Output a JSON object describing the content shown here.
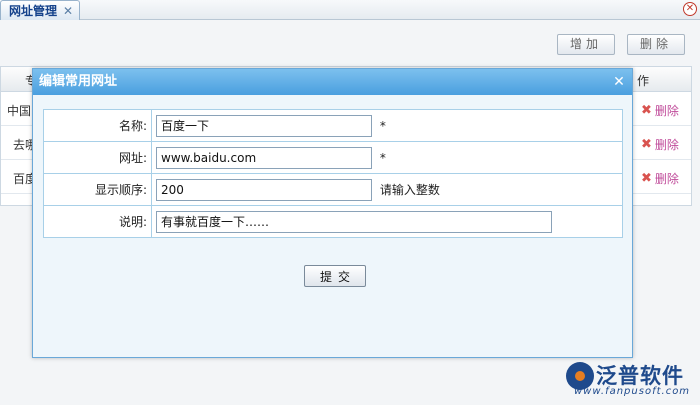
{
  "tab": {
    "label": "网址管理",
    "close_glyph": "✕"
  },
  "window_close_glyph": "✕",
  "toolbar": {
    "add_label": "增加",
    "delete_label": "删除"
  },
  "grid": {
    "header_left_partial": "专",
    "header_right_partial": "作",
    "rows": [
      {
        "name_partial": "中国",
        "delete_label": "删除"
      },
      {
        "name_partial": "去哪",
        "delete_label": "删除"
      },
      {
        "name_partial": "百度",
        "delete_label": "删除"
      }
    ]
  },
  "dialog": {
    "title": "编辑常用网址",
    "close_glyph": "✕",
    "fields": {
      "name": {
        "label": "名称:",
        "value": "百度一下",
        "required_mark": "*"
      },
      "url": {
        "label": "网址:",
        "value": "www.baidu.com",
        "required_mark": "*"
      },
      "order": {
        "label": "显示顺序:",
        "value": "200",
        "hint": "请输入整数"
      },
      "note": {
        "label": "说明:",
        "value": "有事就百度一下……"
      }
    },
    "submit_label": "提交"
  },
  "logo": {
    "text": "泛普软件",
    "url": "www.fanpusoft.com"
  },
  "colors": {
    "dialog_title_bg": "#4a9fdf",
    "delete_icon": "#d9534f",
    "delete_text": "#c04b9a",
    "logo": "#1f4a8c"
  }
}
